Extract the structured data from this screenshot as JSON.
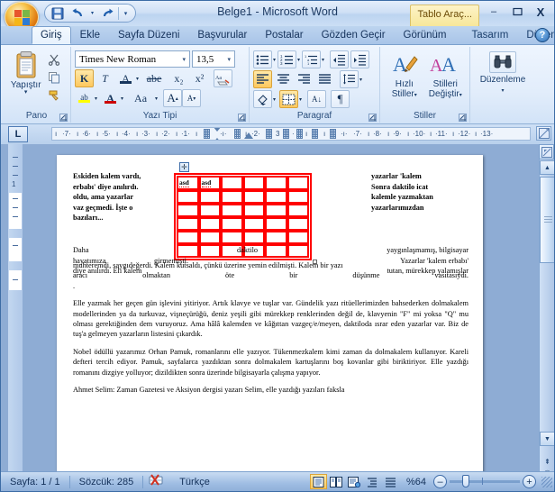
{
  "window": {
    "title": "Belge1 - Microsoft Word",
    "contextual_tab_label": "Tablo Araç...",
    "minimize": "–",
    "maximize": "❐",
    "close": "X",
    "help": "?"
  },
  "quick_access": {
    "save": "save-icon",
    "undo": "undo-icon",
    "undo_arrow": "▾",
    "redo": "redo-icon",
    "customize": "▾"
  },
  "tabs": [
    {
      "label": "Giriş",
      "active": true
    },
    {
      "label": "Ekle",
      "active": false
    },
    {
      "label": "Sayfa Düzeni",
      "active": false
    },
    {
      "label": "Başvurular",
      "active": false
    },
    {
      "label": "Postalar",
      "active": false
    },
    {
      "label": "Gözden Geçir",
      "active": false
    },
    {
      "label": "Görünüm",
      "active": false
    },
    {
      "label": "Tasarım",
      "active": false,
      "contextual": true
    },
    {
      "label": "Düzen",
      "active": false,
      "contextual": true
    }
  ],
  "ribbon": {
    "groups": [
      {
        "name": "Pano",
        "title": "Pano",
        "paste_label": "Yapıştır",
        "paste_arrow": "▾",
        "cut": "✂",
        "copy": "⧉",
        "format_painter": "🖌",
        "launcher": "⌐"
      },
      {
        "name": "Yazı Tipi",
        "title": "Yazı Tipi",
        "font_name": "Times New Roman",
        "font_size": "13,5",
        "bold": "K",
        "italic": "T",
        "underline": "A",
        "strikethrough": "abe",
        "subscript": "x₂",
        "superscript": "x²",
        "clear_formatting": "Aa",
        "highlight": "ab",
        "font_color": "A",
        "change_case": "Aa",
        "grow_font": "A",
        "shrink_font": "A",
        "launcher": "⌐"
      },
      {
        "name": "Paragraf",
        "title": "Paragraf",
        "bullets": "☰",
        "numbering": "☰",
        "multilevel": "☰",
        "decrease_indent": "⇤",
        "increase_indent": "⇥",
        "align_left": "≡",
        "align_center": "≡",
        "align_right": "≡",
        "justify": "≡",
        "line_spacing": "↕",
        "shading": "▩",
        "borders": "⊞",
        "sort": "A↓",
        "show_marks": "¶",
        "launcher": "⌐"
      },
      {
        "name": "Stiller",
        "title": "Stiller",
        "quick_styles_line1": "Hızlı",
        "quick_styles_line2": "Stiller",
        "quick_styles_arrow": "▾",
        "change_styles_line1": "Stilleri",
        "change_styles_line2": "Değiştir",
        "change_styles_arrow": "▾",
        "launcher": "⌐"
      },
      {
        "name": "Düzenleme",
        "title": "",
        "label": "Düzenleme",
        "icon": "binoculars-icon",
        "arrow": "▾"
      }
    ]
  },
  "ruler": {
    "tab_stop_marker": "L",
    "left_numbers": [
      "7",
      "6",
      "5",
      "4",
      "3",
      "2",
      "1"
    ],
    "right_numbers": [
      "1",
      "2",
      "3",
      "4",
      "7",
      "8",
      "9",
      "10",
      "11",
      "12",
      "13"
    ],
    "vertical_numbers": [
      "1"
    ],
    "corner_icon": "ruler-toggle-icon"
  },
  "document": {
    "table": {
      "rows": 6,
      "cols": 6,
      "border_color": "#ff0000",
      "cells": [
        [
          "asd",
          "asd",
          "",
          "",
          "",
          ""
        ],
        [
          "",
          "",
          "",
          "",
          "",
          ""
        ],
        [
          "",
          "",
          "",
          "",
          "",
          ""
        ],
        [
          "",
          "",
          "",
          "",
          "",
          ""
        ],
        [
          "",
          "",
          "",
          "",
          "",
          ""
        ],
        [
          "",
          "",
          "",
          "",
          "",
          ""
        ]
      ],
      "move_handle": "✛"
    },
    "wrap_left": [
      "Eskiden kalem vardı,",
      "erbabı' diye anılırdı.",
      "oldu, ama yazarlar",
      "vaz geçmedi. İşte o",
      "bazıları..."
    ],
    "wrap_right": [
      "yazarlar 'kalem",
      "Sonra daktilo icat",
      "kalemle yazmaktan",
      "yazarlarımızdan"
    ],
    "wrap_below": [
      {
        "left": "Daha",
        "mid": "daktilo",
        "right": "yaygınlaşmamış, bilgisayar"
      },
      {
        "left": "hayatımıza",
        "mid": "girmemişti.",
        "right": "Yazarlar   'kalem   erbabı'"
      },
      {
        "left": "diye  anılırdı.   Eli   kalem",
        "mid": "",
        "right": "tutan, mürekkep yalamışlar"
      }
    ],
    "para2_line1": "muhteremdi, saygıdeğerdi. Kalem kutsaldı, çünkü üzerine yemin edilmişti. Kalem bir yazı",
    "para2_line2_parts": [
      "aracı",
      "olmaktan",
      "öte",
      "bir",
      "düşünme",
      "vasıtasıydı."
    ],
    "para2_dot": ".",
    "para3": "Elle yazmak her geçen gün işlevini yitiriyor. Artık klavye ve tuşlar var. Gündelik yazı ritüellerimizden bahsederken dolmakalem modellerinden ya da turkuvaz, vişneçürüğü, deniz yeşili gibi mürekkep renklerinden değil de, klavyenin \"F\" mi yoksa \"Q\" mu olması gerektiğinden dem vuruyoruz. Ama hâlâ kalemden ve kâğıttan vazgeç/e/meyen, daktiloda ısrar eden yazarlar var. Biz de tuş'a gelmeyen yazarların listesini çıkardık.",
    "para4": "Nobel ödüllü yazarımız Orhan Pamuk, romanlarını elle yazıyor. Tükenmezkalem kimi zaman da dolmakalem kullanıyor. Kareli defteri tercih ediyor. Pamuk, sayfalarca yazdıktan sonra dolmakalem kartuşlarını boş kovanlar gibi biriktiriyor. Elle yazdığı romanını dizgiye yolluyor; dizildikten sonra üzerinde bilgisayarla çalışma yapıyor.",
    "para5_cut": "Ahmet Selim: Zaman Gazetesi ve Aksiyon dergisi yazarı Selim, elle yazdığı yazıları faksla"
  },
  "status_bar": {
    "page": "Sayfa: 1 / 1",
    "words": "Sözcük: 285",
    "proofing_icon": "spelling-error-icon",
    "language": "Türkçe",
    "views": [
      {
        "name": "print-layout",
        "glyph": "▤",
        "active": true
      },
      {
        "name": "full-screen-reading",
        "glyph": "◫",
        "active": false
      },
      {
        "name": "web-layout",
        "glyph": "▦",
        "active": false
      },
      {
        "name": "outline",
        "glyph": "≔",
        "active": false
      },
      {
        "name": "draft",
        "glyph": "☰",
        "active": false
      }
    ],
    "zoom_level": "%64",
    "zoom_out": "–",
    "zoom_in": "+"
  },
  "colors": {
    "accent": "#1f4e8c",
    "table_border": "#ff0000",
    "contextual_tab": "#f7e79a",
    "highlight": "#fdc85e"
  }
}
